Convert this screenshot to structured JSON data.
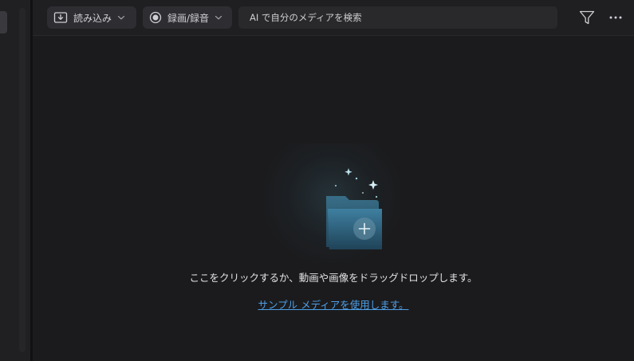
{
  "toolbar": {
    "import_label": "読み込み",
    "record_label": "録画/録音",
    "search_placeholder": "AI で自分のメディアを検索"
  },
  "icons": {
    "import": "import-tray-icon",
    "import_chevron": "chevron-down-icon",
    "record": "record-icon",
    "record_chevron": "chevron-down-icon",
    "filter": "filter-icon",
    "more": "more-dots-icon",
    "folder": "folder-plus-icon"
  },
  "empty_state": {
    "instruction": "ここをクリックするか、動画や画像をドラッグドロップします。",
    "sample_link": "サンプル メディアを使用します。"
  },
  "colors": {
    "background": "#1b1b1d",
    "toolbar": "#1f1f22",
    "button": "#2e2e32",
    "link": "#4d9fe8",
    "folder": "#2f5f78"
  }
}
